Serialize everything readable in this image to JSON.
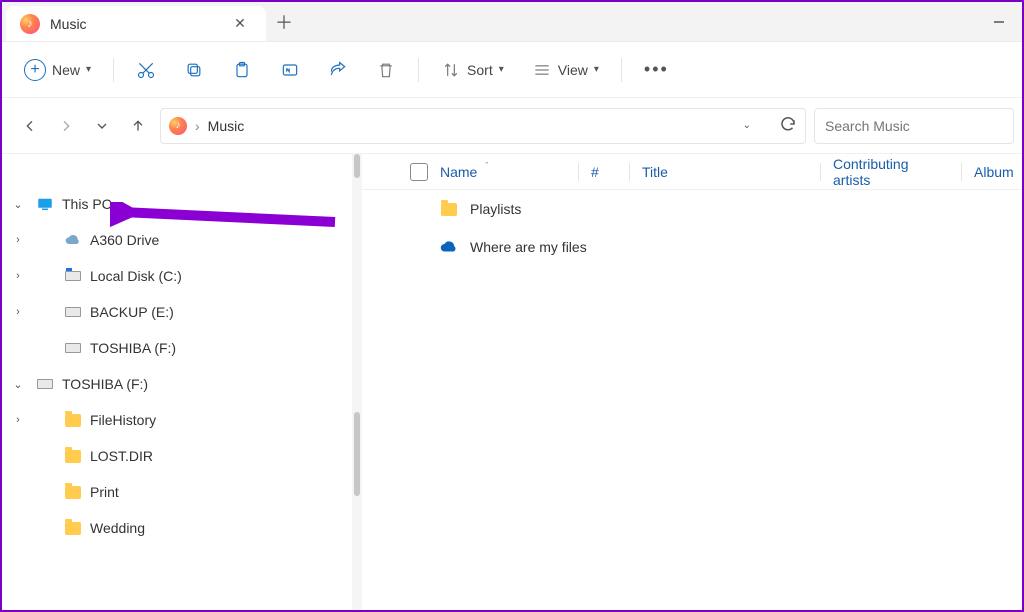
{
  "tab": {
    "title": "Music"
  },
  "toolbar": {
    "new_label": "New",
    "sort_label": "Sort",
    "view_label": "View"
  },
  "address": {
    "crumb": "Music",
    "search_placeholder": "Search Music"
  },
  "sidebar": {
    "this_pc": "This PC",
    "a360": "A360 Drive",
    "localdisk": "Local Disk (C:)",
    "backup": "BACKUP (E:)",
    "toshiba1": "TOSHIBA (F:)",
    "toshiba2": "TOSHIBA (F:)",
    "filehistory": "FileHistory",
    "lostdir": "LOST.DIR",
    "print": "Print",
    "wedding": "Wedding"
  },
  "columns": {
    "name": "Name",
    "num": "#",
    "title": "Title",
    "contrib": "Contributing artists",
    "album": "Album"
  },
  "items": {
    "playlists": "Playlists",
    "where": "Where are my files"
  }
}
